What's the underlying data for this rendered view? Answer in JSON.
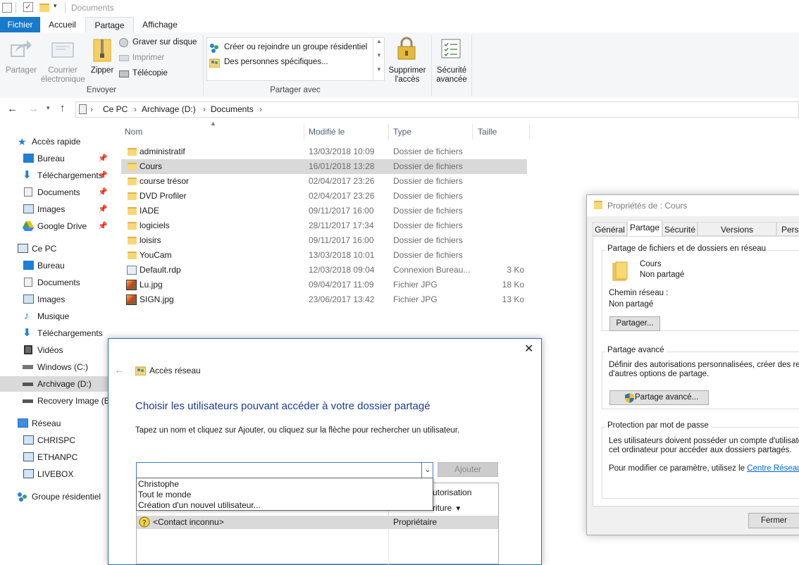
{
  "window": {
    "title": "Documents"
  },
  "ribbon": {
    "tabs": [
      "Fichier",
      "Accueil",
      "Partage",
      "Affichage"
    ],
    "send": {
      "share": "Partager",
      "email_1": "Courrier",
      "email_2": "électronique",
      "zip": "Zipper",
      "burn": "Graver sur disque",
      "print": "Imprimer",
      "fax": "Télécopie",
      "group": "Envoyer"
    },
    "share_with": {
      "item1": "Créer ou rejoindre un groupe résidentiel",
      "item2": "Des personnes spécifiques...",
      "group": "Partager avec"
    },
    "remove_1": "Supprimer",
    "remove_2": "l'accès",
    "security_1": "Sécurité",
    "security_2": "avancée"
  },
  "address": {
    "crumbs": [
      "Ce PC",
      "Archivage (D:)",
      "Documents"
    ]
  },
  "nav": {
    "quick_access": "Accès rapide",
    "quick_items": [
      "Bureau",
      "Téléchargements",
      "Documents",
      "Images",
      "Google Drive"
    ],
    "this_pc": "Ce PC",
    "pc_items": [
      "Bureau",
      "Documents",
      "Images",
      "Musique",
      "Téléchargements",
      "Vidéos",
      "Windows (C:)",
      "Archivage (D:)",
      "Recovery Image (E:"
    ],
    "network": "Réseau",
    "network_items": [
      "CHRISPC",
      "ETHANPC",
      "LIVEBOX"
    ],
    "homegroup": "Groupe résidentiel"
  },
  "files": {
    "headers": {
      "name": "Nom",
      "modified": "Modifié le",
      "type": "Type",
      "size": "Taille"
    },
    "rows": [
      {
        "name": "administratif",
        "date": "13/03/2018 10:09",
        "type": "Dossier de fichiers",
        "size": "",
        "kind": "folder"
      },
      {
        "name": "Cours",
        "date": "16/01/2018 13:28",
        "type": "Dossier de fichiers",
        "size": "",
        "kind": "folder"
      },
      {
        "name": "course trésor",
        "date": "02/04/2017 23:26",
        "type": "Dossier de fichiers",
        "size": "",
        "kind": "folder"
      },
      {
        "name": "DVD Profiler",
        "date": "02/04/2017 23:26",
        "type": "Dossier de fichiers",
        "size": "",
        "kind": "folder"
      },
      {
        "name": "IADE",
        "date": "09/11/2017 16:00",
        "type": "Dossier de fichiers",
        "size": "",
        "kind": "folder"
      },
      {
        "name": "logiciels",
        "date": "28/11/2017 17:34",
        "type": "Dossier de fichiers",
        "size": "",
        "kind": "folder"
      },
      {
        "name": "loisirs",
        "date": "09/11/2017 16:00",
        "type": "Dossier de fichiers",
        "size": "",
        "kind": "folder"
      },
      {
        "name": "YouCam",
        "date": "13/03/2018 10:01",
        "type": "Dossier de fichiers",
        "size": "",
        "kind": "folder"
      },
      {
        "name": "Default.rdp",
        "date": "12/03/2018 09:04",
        "type": "Connexion Bureau...",
        "size": "3 Ko",
        "kind": "rdp"
      },
      {
        "name": "Lu.jpg",
        "date": "09/04/2017 11:09",
        "type": "Fichier JPG",
        "size": "18 Ko",
        "kind": "img"
      },
      {
        "name": "SIGN.jpg",
        "date": "23/06/2017 13:42",
        "type": "Fichier JPG",
        "size": "13 Ko",
        "kind": "img"
      }
    ]
  },
  "props": {
    "title": "Propriétés de : Cours",
    "tabs": [
      "Général",
      "Partage",
      "Sécurité",
      "Versions précédentes",
      "Perso"
    ],
    "net_share_group": "Partage de fichiers et de dossiers en réseau",
    "folder_name": "Cours",
    "folder_status": "Non partagé",
    "path_label": "Chemin réseau :",
    "path_value": "Non partagé",
    "share_btn": "Partager...",
    "adv_group": "Partage avancé",
    "adv_text_1": "Définir des autorisations personnalisées, créer des ressou",
    "adv_text_2": "d'autres options de partage.",
    "adv_btn": "Partage avancé...",
    "pwd_group": "Protection par mot de passe",
    "pwd_text_1": "Les utilisateurs doivent posséder un compte d'utilisateur e",
    "pwd_text_2": "cet ordinateur pour accéder aux dossiers partagés.",
    "pwd_text_3": "Pour modifier ce paramètre, utilisez le ",
    "pwd_link": "Centre Réseau et pa",
    "close_btn": "Fermer"
  },
  "net": {
    "title": "Accès réseau",
    "heading": "Choisir les utilisateurs pouvant accéder à votre dossier partagé",
    "instruction": "Tapez un nom et cliquez sur Ajouter, ou cliquez sur la flèche pour rechercher un utilisateur.",
    "input_value": "",
    "add_btn": "Ajouter",
    "dropdown": [
      "Christophe",
      "Tout le monde",
      "Création d'un nouvel utilisateur..."
    ],
    "col_perm_partial": "utorisation",
    "perm_partial": "riture",
    "user": "<Contact inconnu>",
    "user_perm": "Propriétaire"
  }
}
